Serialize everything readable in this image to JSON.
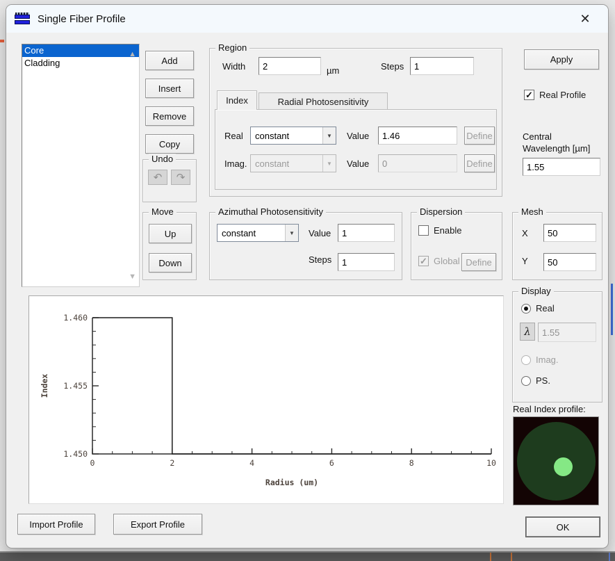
{
  "window": {
    "title": "Single Fiber Profile"
  },
  "ui_icons": {
    "close": "✕",
    "check": "✓",
    "dropdown_arrow": "▼",
    "scroll_up": "▲",
    "scroll_down": "▼",
    "undo": "↶",
    "redo": "↷"
  },
  "layers": {
    "items": [
      {
        "label": "Core",
        "selected": true
      },
      {
        "label": "Cladding",
        "selected": false
      }
    ]
  },
  "actions": {
    "add": "Add",
    "insert": "Insert",
    "remove": "Remove",
    "copy": "Copy"
  },
  "undo": {
    "legend": "Undo"
  },
  "move": {
    "legend": "Move",
    "up": "Up",
    "down": "Down"
  },
  "region": {
    "legend": "Region",
    "width_label": "Width",
    "width_value": "2",
    "width_unit": "µm",
    "steps_label": "Steps",
    "steps_value": "1",
    "tabs": [
      {
        "label": "Index"
      },
      {
        "label": "Radial Photosensitivity"
      }
    ],
    "index_tab": {
      "real_label": "Real",
      "real_mode": "constant",
      "real_value_label": "Value",
      "real_value": "1.46",
      "real_define": "Define",
      "imag_label": "Imag.",
      "imag_mode": "constant",
      "imag_value_label": "Value",
      "imag_value": "0",
      "imag_define": "Define"
    }
  },
  "right_panel": {
    "apply": "Apply",
    "real_profile_label": "Real Profile",
    "real_profile_checked": true,
    "central_wavelength_line1": "Central",
    "central_wavelength_line2": "Wavelength [µm]",
    "central_wavelength_value": "1.55"
  },
  "azimuthal": {
    "legend": "Azimuthal Photosensitivity",
    "mode": "constant",
    "value_label": "Value",
    "value": "1",
    "steps_label": "Steps",
    "steps": "1"
  },
  "dispersion": {
    "legend": "Dispersion",
    "enable_label": "Enable",
    "enable_checked": false,
    "global_label": "Global",
    "global_checked": true,
    "define_label": "Define"
  },
  "mesh": {
    "legend": "Mesh",
    "x_label": "X",
    "x_value": "50",
    "y_label": "Y",
    "y_value": "50"
  },
  "display": {
    "legend": "Display",
    "real_label": "Real",
    "lambda_icon": "λ",
    "lambda_value": "1.55",
    "imag_label": "Imag.",
    "ps_label": "PS.",
    "selected": "real"
  },
  "preview": {
    "label": "Real Index profile:",
    "bg_color": "#130404",
    "cladding_color": "#1e3c1e",
    "core_color": "#85e885"
  },
  "footer": {
    "import": "Import Profile",
    "export": "Export Profile",
    "ok": "OK"
  },
  "chart_data": {
    "type": "line",
    "x": [
      0,
      2,
      2,
      10
    ],
    "y": [
      1.46,
      1.46,
      1.45,
      1.45
    ],
    "xlabel": "Radius (um)",
    "ylabel": "Index",
    "xlim": [
      0,
      10
    ],
    "ylim": [
      1.45,
      1.46
    ],
    "xticks_major": [
      0,
      2,
      4,
      6,
      8,
      10
    ],
    "xtick_minor_step": 0.5,
    "yticks_major": [
      1.45,
      1.455,
      1.46
    ],
    "ytick_minor_step": 0.001,
    "grid": false,
    "legend_position": "none",
    "line_color": "#1c1c1c",
    "axis_color": "#2a2a2a"
  }
}
